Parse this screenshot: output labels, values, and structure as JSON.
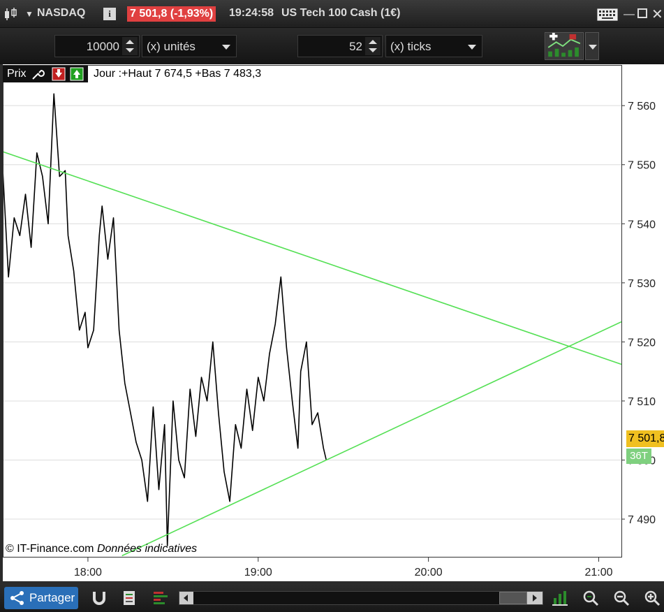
{
  "titlebar": {
    "symbol": "NASDAQ",
    "info_icon": "i",
    "price_change": "7 501,8 (-1,93%)",
    "time": "19:24:58",
    "instrument": "US Tech 100 Cash (1€)",
    "icons": [
      "candlestick-icon",
      "keyboard-icon",
      "minimize-icon",
      "maximize-icon",
      "close-icon"
    ]
  },
  "toolbar": {
    "units_value": "10000",
    "units_label": "(x) unités",
    "ticks_value": "52",
    "ticks_label": "(x) ticks"
  },
  "legend": {
    "prix_label": "Prix",
    "jour_text": "Jour :+Haut 7 674,5 +Bas 7 483,3",
    "copyright": "© IT-Finance.com",
    "indicative": "Données indicatives"
  },
  "price_tags": {
    "last_price": "7 501,8",
    "ticks": "36T"
  },
  "bottombar": {
    "share_label": "Partager"
  },
  "colors": {
    "price_line": "#000000",
    "trend_line": "#55e055",
    "last_price_bg": "#f0c020",
    "ticks_bg": "#7fd07f",
    "change_badge": "#e04040",
    "share_button": "#2a6fb8"
  },
  "chart_data": {
    "type": "line",
    "title": "US Tech 100 Cash (1€)",
    "grid": true,
    "x_ticks": [
      "18:00",
      "19:00",
      "20:00",
      "21:00"
    ],
    "x_range": [
      "17:30",
      "21:08"
    ],
    "ylim": [
      7483.5,
      7567
    ],
    "y_ticks": [
      7490,
      7500,
      7510,
      7520,
      7530,
      7540,
      7550,
      7560
    ],
    "y_tick_labels": [
      "7 490",
      "7 500",
      "7 510",
      "7 520",
      "7 530",
      "7 540",
      "7 550",
      "7 560"
    ],
    "series": [
      {
        "key": "price",
        "x": [
          "17:30",
          "17:32",
          "17:34",
          "17:36",
          "17:38",
          "17:40",
          "17:42",
          "17:44",
          "17:46",
          "17:48",
          "17:50",
          "17:52",
          "17:53",
          "17:55",
          "17:57",
          "17:59",
          "18:00",
          "18:02",
          "18:04",
          "18:05",
          "18:07",
          "18:09",
          "18:11",
          "18:13",
          "18:15",
          "18:17",
          "18:19",
          "18:21",
          "18:23",
          "18:25",
          "18:27",
          "18:28",
          "18:30",
          "18:32",
          "18:34",
          "18:36",
          "18:38",
          "18:40",
          "18:42",
          "18:44",
          "18:46",
          "18:48",
          "18:50",
          "18:52",
          "18:54",
          "18:56",
          "18:58",
          "19:00",
          "19:02",
          "19:04",
          "19:06",
          "19:08",
          "19:10",
          "19:12",
          "19:14",
          "19:15",
          "19:17",
          "19:19",
          "19:21",
          "19:23",
          "19:24"
        ],
        "values": [
          7549,
          7531,
          7541,
          7538,
          7545,
          7536,
          7552,
          7548,
          7540,
          7562,
          7548,
          7549,
          7538,
          7532,
          7522,
          7525,
          7519,
          7522,
          7538,
          7543,
          7534,
          7541,
          7522,
          7513,
          7508,
          7503,
          7500,
          7493,
          7509,
          7495,
          7506,
          7485.5,
          7510,
          7500,
          7497,
          7512,
          7504,
          7514,
          7510,
          7520,
          7508,
          7498,
          7493,
          7506,
          7502,
          7512,
          7505,
          7514,
          7510,
          7518,
          7523,
          7531,
          7519,
          7510,
          7502,
          7515,
          7520,
          7506,
          7508,
          7502,
          7500
        ]
      },
      {
        "key": "resistance",
        "x": [
          "17:30",
          "21:08"
        ],
        "values": [
          7552.2,
          7516.2
        ]
      },
      {
        "key": "support",
        "x": [
          "18:12",
          "21:08"
        ],
        "values": [
          7483.8,
          7523.4
        ]
      }
    ]
  }
}
